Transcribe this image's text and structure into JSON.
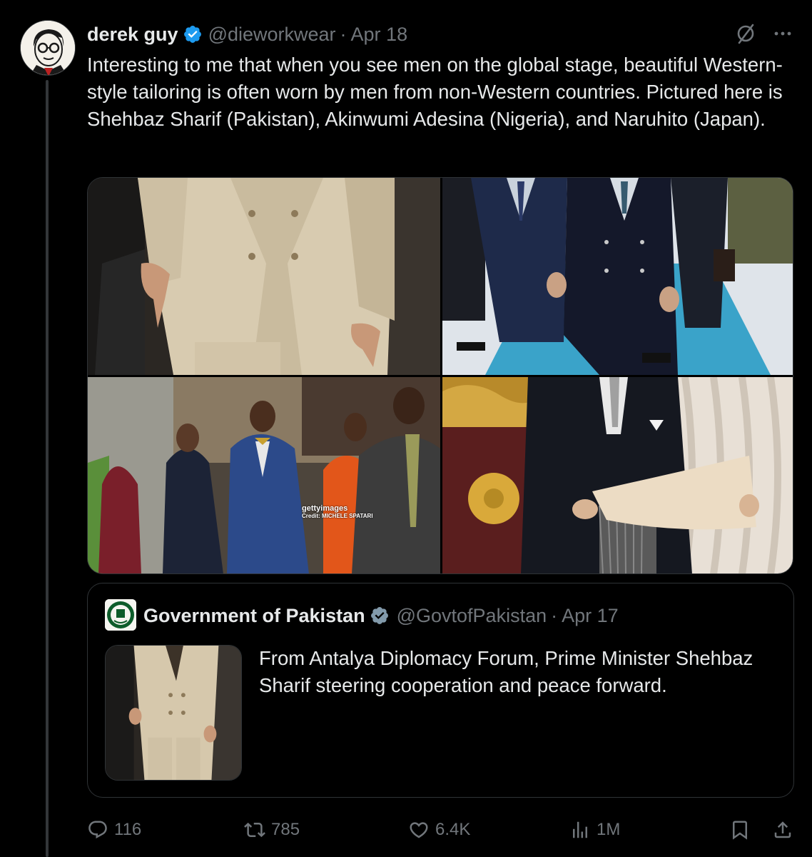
{
  "tweet": {
    "author_name": "derek guy",
    "author_handle": "@dieworkwear",
    "separator": "·",
    "date": "Apr 18",
    "text": "Interesting to me that when you see men on the global stage, beautiful Western-style tailoring is often worn by men from non-Western countries. Pictured here is Shehbaz Sharif (Pakistan), Akinwumi Adesina (Nigeria), and Naruhito (Japan).",
    "photo_watermark": {
      "logo": "gettyimages",
      "credit": "Credit: MICHELE SPATARI"
    }
  },
  "quoted_tweet": {
    "author_name": "Government of Pakistan",
    "author_handle": "@GovtofPakistan",
    "separator": "·",
    "date": "Apr 17",
    "text": "From Antalya Diplomacy Forum, Prime Minister Shehbaz Sharif steering cooperation and peace forward."
  },
  "actions": {
    "replies": "116",
    "reposts": "785",
    "likes": "6.4K",
    "views": "1M"
  },
  "colors": {
    "background": "#000000",
    "text_primary": "#e7e9ea",
    "text_secondary": "#71767b",
    "border": "#2f3336",
    "verified_blue": "#1d9bf0",
    "verified_gray": "#829aab"
  },
  "icons": [
    "grok-icon",
    "more-icon",
    "verified-icon",
    "reply-icon",
    "retweet-icon",
    "like-icon",
    "views-icon",
    "bookmark-icon",
    "share-icon"
  ]
}
